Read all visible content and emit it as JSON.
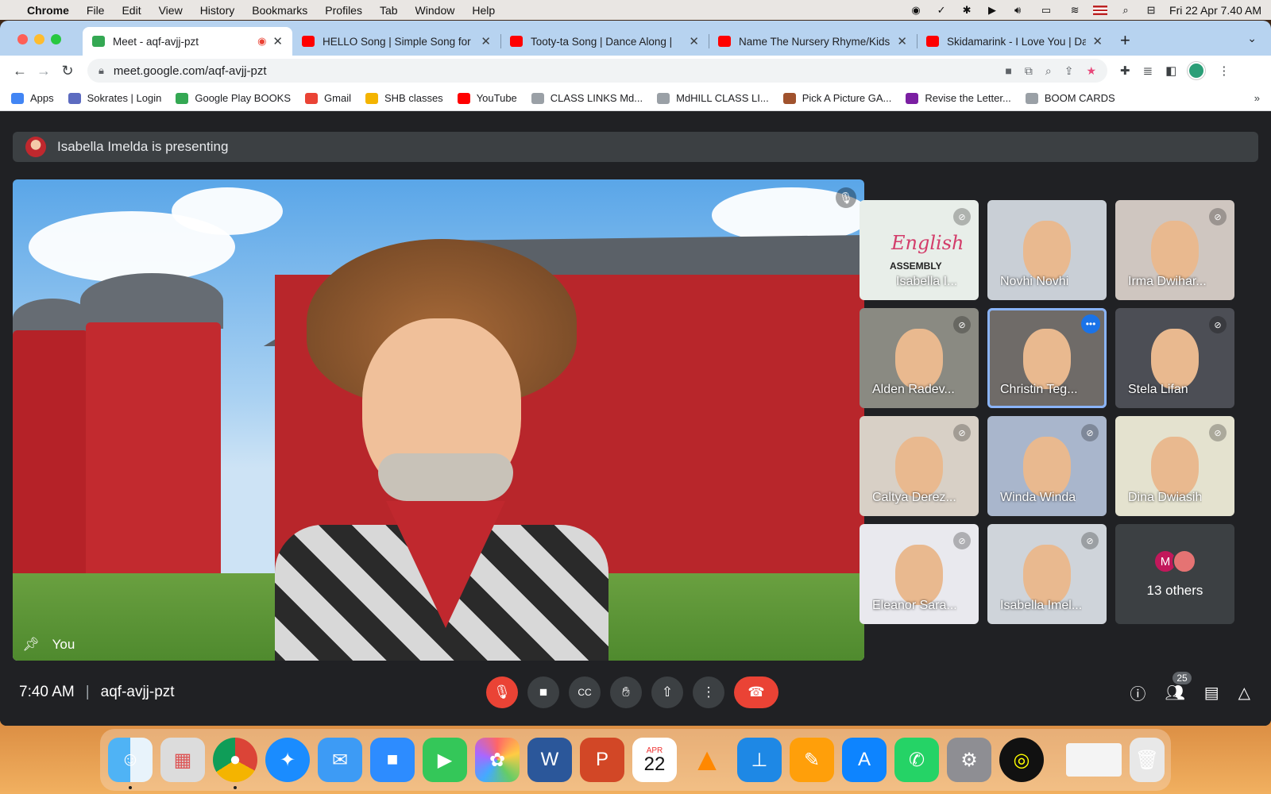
{
  "menubar": {
    "app": "Chrome",
    "items": [
      "File",
      "Edit",
      "View",
      "History",
      "Bookmarks",
      "Profiles",
      "Tab",
      "Window",
      "Help"
    ],
    "datetime": "Fri 22 Apr  7.40 AM"
  },
  "tabs": [
    {
      "title": "Meet - aqf-avjj-pzt",
      "color": "#34a853"
    },
    {
      "title": "HELLO Song | Simple Song for",
      "color": "#ff0000"
    },
    {
      "title": "Tooty-ta Song | Dance Along |",
      "color": "#ff0000"
    },
    {
      "title": "Name The Nursery Rhyme/Kids",
      "color": "#ff0000"
    },
    {
      "title": "Skidamarink - I Love You | Danc",
      "color": "#ff0000"
    }
  ],
  "address": "meet.google.com/aqf-avjj-pzt",
  "bookmarks": [
    {
      "label": "Apps",
      "color": "#4285f4"
    },
    {
      "label": "Sokrates | Login",
      "color": "#5c6bc0"
    },
    {
      "label": "Google Play BOOKS",
      "color": "#34a853"
    },
    {
      "label": "Gmail",
      "color": "#ea4335"
    },
    {
      "label": "SHB classes",
      "color": "#f4b400"
    },
    {
      "label": "YouTube",
      "color": "#ff0000"
    },
    {
      "label": "CLASS LINKS Md...",
      "color": "#9aa0a6"
    },
    {
      "label": "MdHILL CLASS LI...",
      "color": "#9aa0a6"
    },
    {
      "label": "Pick A Picture GA...",
      "color": "#a0522d"
    },
    {
      "label": "Revise the Letter...",
      "color": "#7b1fa2"
    },
    {
      "label": "BOOM CARDS",
      "color": "#9aa0a6"
    }
  ],
  "banner": "Isabella Imelda is presenting",
  "main_video": {
    "label": "You"
  },
  "tiles": [
    {
      "name": "Isabella I...",
      "muted": true,
      "bg": "#dde9e2",
      "slide_title": "English",
      "slide_sub": "ASSEMBLY"
    },
    {
      "name": "Novhi Novhi",
      "muted": false,
      "bg": "#c9cfd6"
    },
    {
      "name": "Irma Dwihar...",
      "muted": true,
      "bg": "#cfc6c0"
    },
    {
      "name": "Alden Radev...",
      "muted": true,
      "bg": "#8a8a82"
    },
    {
      "name": "Christin Teg...",
      "muted": false,
      "bg": "#6f6b68",
      "active": true
    },
    {
      "name": "Stela Lifan",
      "muted": true,
      "bg": "#4c4e55"
    },
    {
      "name": "Caltya Derez...",
      "muted": true,
      "bg": "#d8d0c6"
    },
    {
      "name": "Winda Winda",
      "muted": true,
      "bg": "#a9b6cc"
    },
    {
      "name": "Dina Dwiasih",
      "muted": true,
      "bg": "#e4e2cf"
    },
    {
      "name": "Eleanor Sara...",
      "muted": true,
      "bg": "#e9e9ee"
    },
    {
      "name": "Isabella Imel...",
      "muted": true,
      "bg": "#cfd4da"
    }
  ],
  "others": {
    "initial": "M",
    "label": "13 others"
  },
  "bottom": {
    "time": "7:40 AM",
    "code": "aqf-avjj-pzt",
    "people_count": "25"
  },
  "dock": {
    "calendar_month": "APR",
    "calendar_day": "22"
  }
}
